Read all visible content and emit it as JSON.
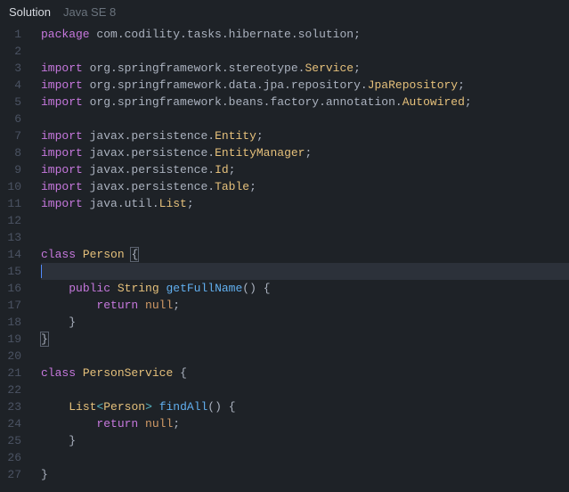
{
  "header": {
    "tab_label": "Solution",
    "language_label": "Java SE 8"
  },
  "code": {
    "lines": [
      {
        "n": 1,
        "tokens": [
          [
            "kw",
            "package"
          ],
          [
            "sp",
            " "
          ],
          [
            "pkg",
            "com.codility.tasks.hibernate.solution"
          ],
          [
            "punct",
            ";"
          ]
        ]
      },
      {
        "n": 2,
        "tokens": []
      },
      {
        "n": 3,
        "tokens": [
          [
            "kw",
            "import"
          ],
          [
            "sp",
            " "
          ],
          [
            "pkg",
            "org.springframework.stereotype."
          ],
          [
            "cls",
            "Service"
          ],
          [
            "punct",
            ";"
          ]
        ]
      },
      {
        "n": 4,
        "tokens": [
          [
            "kw",
            "import"
          ],
          [
            "sp",
            " "
          ],
          [
            "pkg",
            "org.springframework.data.jpa.repository."
          ],
          [
            "cls",
            "JpaRepository"
          ],
          [
            "punct",
            ";"
          ]
        ]
      },
      {
        "n": 5,
        "tokens": [
          [
            "kw",
            "import"
          ],
          [
            "sp",
            " "
          ],
          [
            "pkg",
            "org.springframework.beans.factory.annotation."
          ],
          [
            "cls",
            "Autowired"
          ],
          [
            "punct",
            ";"
          ]
        ]
      },
      {
        "n": 6,
        "tokens": []
      },
      {
        "n": 7,
        "tokens": [
          [
            "kw",
            "import"
          ],
          [
            "sp",
            " "
          ],
          [
            "pkg",
            "javax.persistence."
          ],
          [
            "cls",
            "Entity"
          ],
          [
            "punct",
            ";"
          ]
        ]
      },
      {
        "n": 8,
        "tokens": [
          [
            "kw",
            "import"
          ],
          [
            "sp",
            " "
          ],
          [
            "pkg",
            "javax.persistence."
          ],
          [
            "cls",
            "EntityManager"
          ],
          [
            "punct",
            ";"
          ]
        ]
      },
      {
        "n": 9,
        "tokens": [
          [
            "kw",
            "import"
          ],
          [
            "sp",
            " "
          ],
          [
            "pkg",
            "javax.persistence."
          ],
          [
            "cls",
            "Id"
          ],
          [
            "punct",
            ";"
          ]
        ]
      },
      {
        "n": 10,
        "tokens": [
          [
            "kw",
            "import"
          ],
          [
            "sp",
            " "
          ],
          [
            "pkg",
            "javax.persistence."
          ],
          [
            "cls",
            "Table"
          ],
          [
            "punct",
            ";"
          ]
        ]
      },
      {
        "n": 11,
        "tokens": [
          [
            "kw",
            "import"
          ],
          [
            "sp",
            " "
          ],
          [
            "pkg",
            "java.util."
          ],
          [
            "cls",
            "List"
          ],
          [
            "punct",
            ";"
          ]
        ]
      },
      {
        "n": 12,
        "tokens": []
      },
      {
        "n": 13,
        "tokens": []
      },
      {
        "n": 14,
        "tokens": [
          [
            "kw",
            "class"
          ],
          [
            "sp",
            " "
          ],
          [
            "cls",
            "Person"
          ],
          [
            "sp",
            " "
          ],
          [
            "punct-hl",
            "{"
          ]
        ]
      },
      {
        "n": 15,
        "tokens": [],
        "current": true,
        "cursor": true
      },
      {
        "n": 16,
        "tokens": [
          [
            "sp",
            "    "
          ],
          [
            "kw",
            "public"
          ],
          [
            "sp",
            " "
          ],
          [
            "type",
            "String"
          ],
          [
            "sp",
            " "
          ],
          [
            "fn",
            "getFullName"
          ],
          [
            "punct",
            "()"
          ],
          [
            "sp",
            " "
          ],
          [
            "punct",
            "{"
          ]
        ]
      },
      {
        "n": 17,
        "tokens": [
          [
            "sp",
            "        "
          ],
          [
            "kw",
            "return"
          ],
          [
            "sp",
            " "
          ],
          [
            "null",
            "null"
          ],
          [
            "punct",
            ";"
          ]
        ]
      },
      {
        "n": 18,
        "tokens": [
          [
            "sp",
            "    "
          ],
          [
            "punct",
            "}"
          ]
        ]
      },
      {
        "n": 19,
        "tokens": [
          [
            "punct-hl",
            "}"
          ]
        ]
      },
      {
        "n": 20,
        "tokens": []
      },
      {
        "n": 21,
        "tokens": [
          [
            "kw",
            "class"
          ],
          [
            "sp",
            " "
          ],
          [
            "cls",
            "PersonService"
          ],
          [
            "sp",
            " "
          ],
          [
            "punct",
            "{"
          ]
        ]
      },
      {
        "n": 22,
        "tokens": []
      },
      {
        "n": 23,
        "tokens": [
          [
            "sp",
            "    "
          ],
          [
            "type",
            "List"
          ],
          [
            "op",
            "<"
          ],
          [
            "type",
            "Person"
          ],
          [
            "op",
            ">"
          ],
          [
            "sp",
            " "
          ],
          [
            "fn",
            "findAll"
          ],
          [
            "punct",
            "()"
          ],
          [
            "sp",
            " "
          ],
          [
            "punct",
            "{"
          ]
        ]
      },
      {
        "n": 24,
        "tokens": [
          [
            "sp",
            "        "
          ],
          [
            "kw",
            "return"
          ],
          [
            "sp",
            " "
          ],
          [
            "null",
            "null"
          ],
          [
            "punct",
            ";"
          ]
        ]
      },
      {
        "n": 25,
        "tokens": [
          [
            "sp",
            "    "
          ],
          [
            "punct",
            "}"
          ]
        ]
      },
      {
        "n": 26,
        "tokens": []
      },
      {
        "n": 27,
        "tokens": [
          [
            "punct",
            "}"
          ]
        ]
      }
    ]
  }
}
